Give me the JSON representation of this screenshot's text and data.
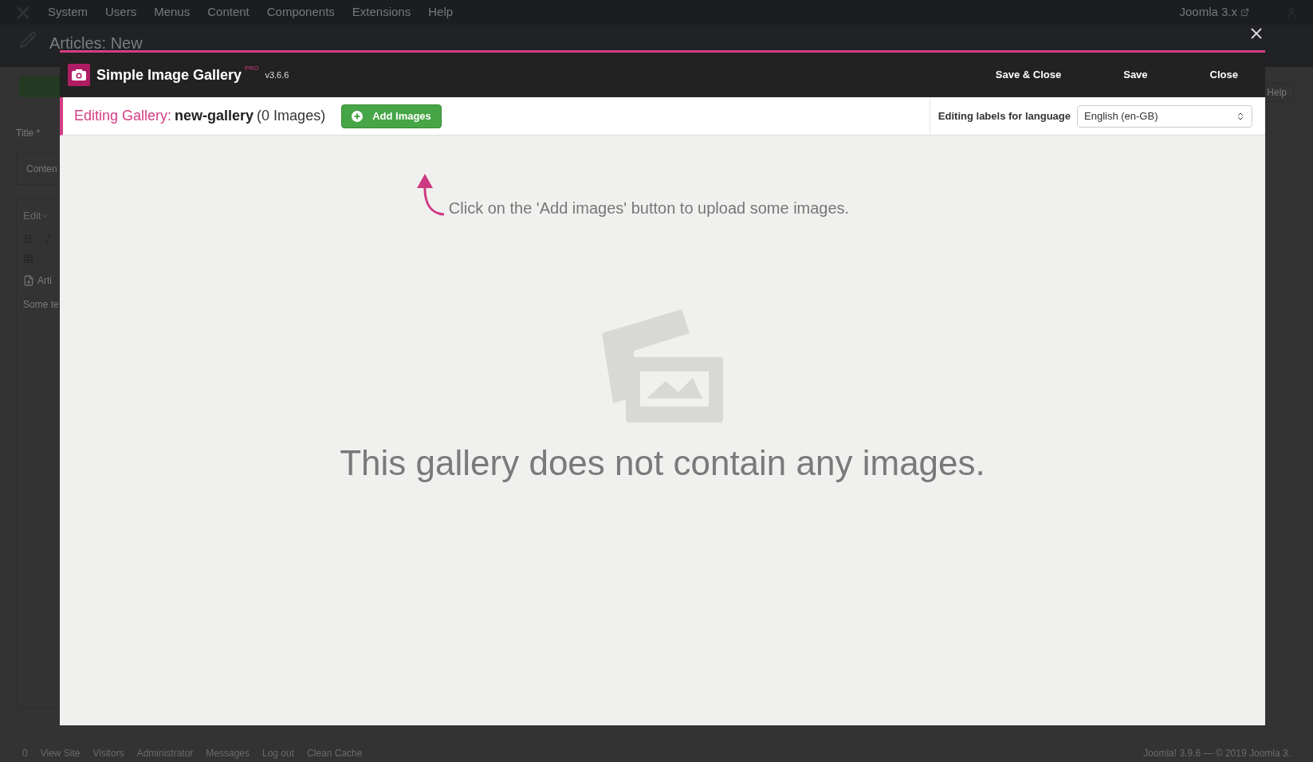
{
  "admin_menu": {
    "items": [
      "System",
      "Users",
      "Menus",
      "Content",
      "Components",
      "Extensions",
      "Help"
    ],
    "site_link": "Joomla 3.x"
  },
  "page_title": "Articles: New",
  "help_button": "Help",
  "form": {
    "title_label": "Title *",
    "content_tab": "Conten",
    "editor_menu": "Edit",
    "toolbar_item": "Arti",
    "editor_text": "Some te"
  },
  "status_bar": {
    "users_count": "0",
    "links": [
      "View Site",
      "Visitors",
      "Administrator",
      "Messages",
      "Log out",
      "Clean Cache"
    ],
    "footer": "Joomla! 3.9.6  —  © 2019 Joomla 3."
  },
  "modal": {
    "title": "Simple Image Gallery",
    "edition": "PRO",
    "version": "v3.6.6",
    "actions": [
      "Save & Close",
      "Save",
      "Close"
    ],
    "editing_label": "Editing Gallery:",
    "gallery_name": "new-gallery",
    "image_count": "(0 Images)",
    "add_button": "Add Images",
    "language_label": "Editing labels for language",
    "language": "English (en-GB)",
    "hint": "Click on the 'Add images' button to upload some images.",
    "empty_message": "This gallery does not contain any images."
  }
}
